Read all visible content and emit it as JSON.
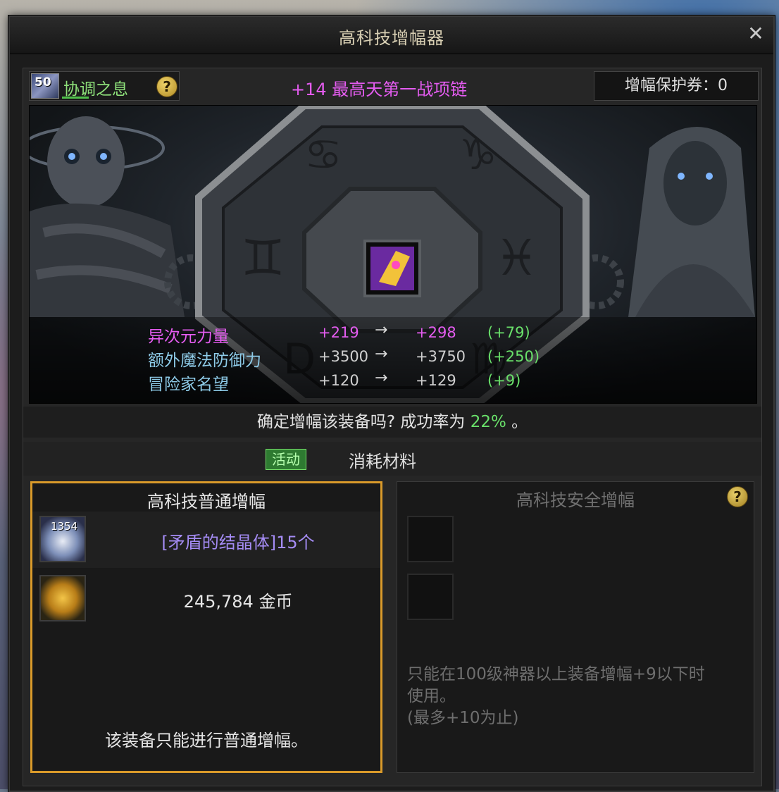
{
  "window": {
    "title": "高科技增幅器",
    "close_label": "✕"
  },
  "header": {
    "title_badge": {
      "level": "50",
      "name": "协调之息"
    },
    "help_label": "?",
    "item_name": "+14 最高天第一战项链",
    "protect_label": "增幅保护券：0"
  },
  "stats": [
    {
      "name": "异次元力量",
      "from": "+219",
      "to": "+298",
      "diff": "(+79)",
      "color": "#e45cf0"
    },
    {
      "name": "额外魔法防御力",
      "from": "+3500",
      "to": "+3750",
      "diff": "(+250)",
      "color": "#8ecbe8"
    },
    {
      "name": "冒险家名望",
      "from": "+120",
      "to": "+129",
      "diff": "(+9)",
      "color": "#8ecbe8"
    }
  ],
  "stat_arrow": "→",
  "confirm": {
    "text": "确定增幅该装备吗? 成功率为",
    "rate": "22%",
    "suffix": "。"
  },
  "tabs": {
    "event_label": "活动",
    "materials_label": "消耗材料"
  },
  "normal_card": {
    "title": "高科技普通增幅",
    "crystal_count": "1354",
    "crystal_text": "[矛盾的结晶体]15个",
    "gold_text": "245,784 金币",
    "note": "该装备只能进行普通增幅。"
  },
  "safe_card": {
    "title": "高科技安全增幅",
    "help_label": "?",
    "note_line1": "只能在100级神器以上装备增幅+9以下时",
    "note_line2": "使用。",
    "note_line3": "(最多+10为止)"
  }
}
